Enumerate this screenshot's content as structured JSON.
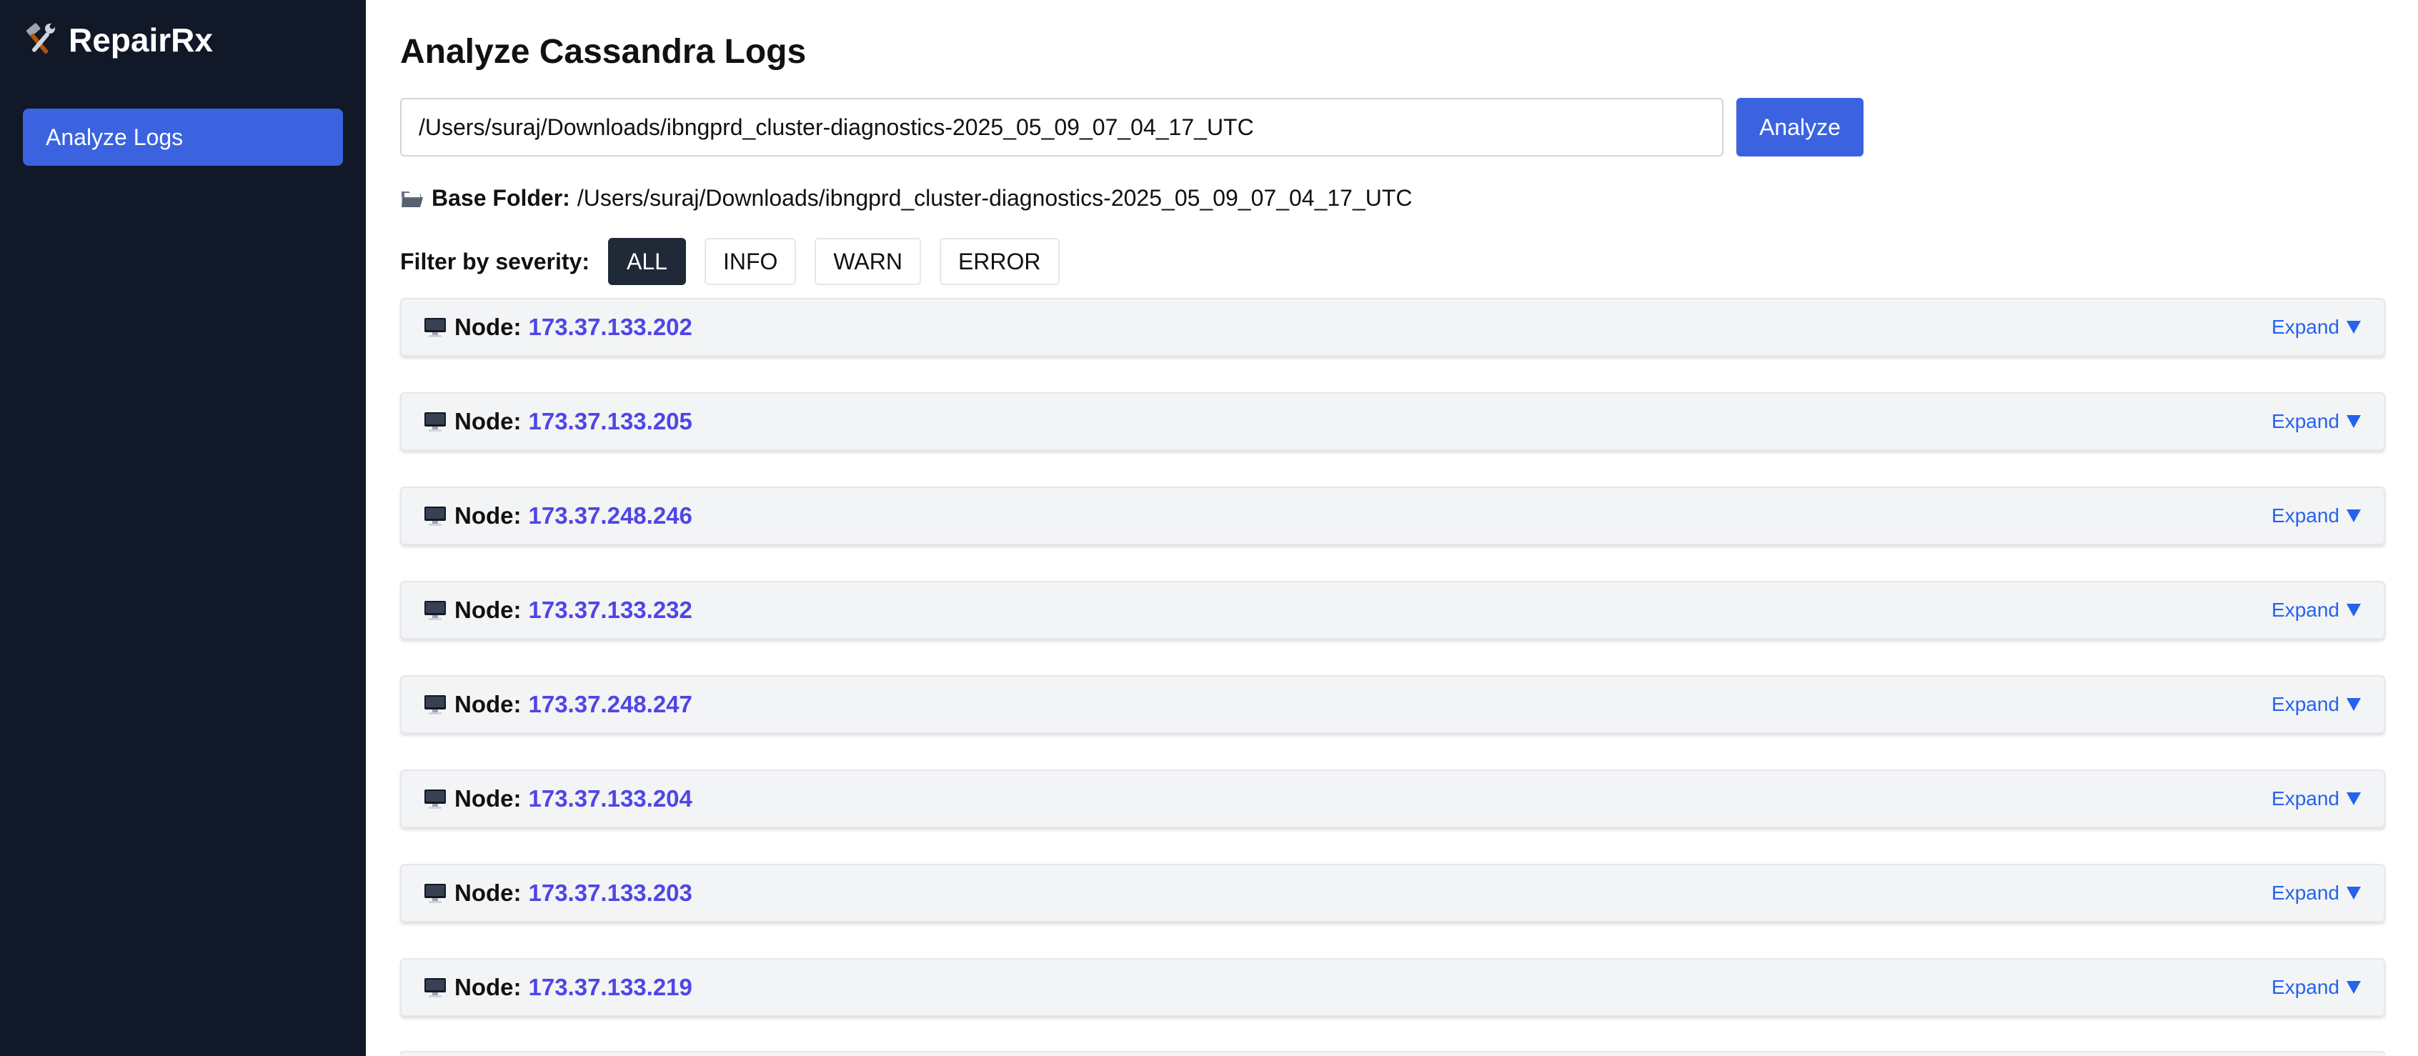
{
  "sidebar": {
    "brand": "RepairRx",
    "brand_icon": "tools-icon",
    "items": [
      {
        "label": "Analyze Logs",
        "active": true
      }
    ]
  },
  "main": {
    "title": "Analyze Cassandra Logs",
    "path_input": {
      "value": "/Users/suraj/Downloads/ibngprd_cluster-diagnostics-2025_05_09_07_04_17_UTC"
    },
    "analyze_label": "Analyze",
    "base_folder": {
      "icon": "open-folder-icon",
      "label": "Base Folder:",
      "value": "/Users/suraj/Downloads/ibngprd_cluster-diagnostics-2025_05_09_07_04_17_UTC"
    },
    "filter": {
      "label": "Filter by severity:",
      "options": [
        "ALL",
        "INFO",
        "WARN",
        "ERROR"
      ],
      "selected": "ALL"
    },
    "nodes": [
      {
        "label": "Node:",
        "ip": "173.37.133.202",
        "expand": "Expand"
      },
      {
        "label": "Node:",
        "ip": "173.37.133.205",
        "expand": "Expand"
      },
      {
        "label": "Node:",
        "ip": "173.37.248.246",
        "expand": "Expand"
      },
      {
        "label": "Node:",
        "ip": "173.37.133.232",
        "expand": "Expand"
      },
      {
        "label": "Node:",
        "ip": "173.37.248.247",
        "expand": "Expand"
      },
      {
        "label": "Node:",
        "ip": "173.37.133.204",
        "expand": "Expand"
      },
      {
        "label": "Node:",
        "ip": "173.37.133.203",
        "expand": "Expand"
      },
      {
        "label": "Node:",
        "ip": "173.37.133.219",
        "expand": "Expand"
      }
    ]
  },
  "colors": {
    "sidebar_bg": "#111827",
    "accent": "#3b63e0",
    "node_ip": "#4f46e5",
    "expand_link": "#2563eb",
    "filter_active_bg": "#1f2937"
  }
}
